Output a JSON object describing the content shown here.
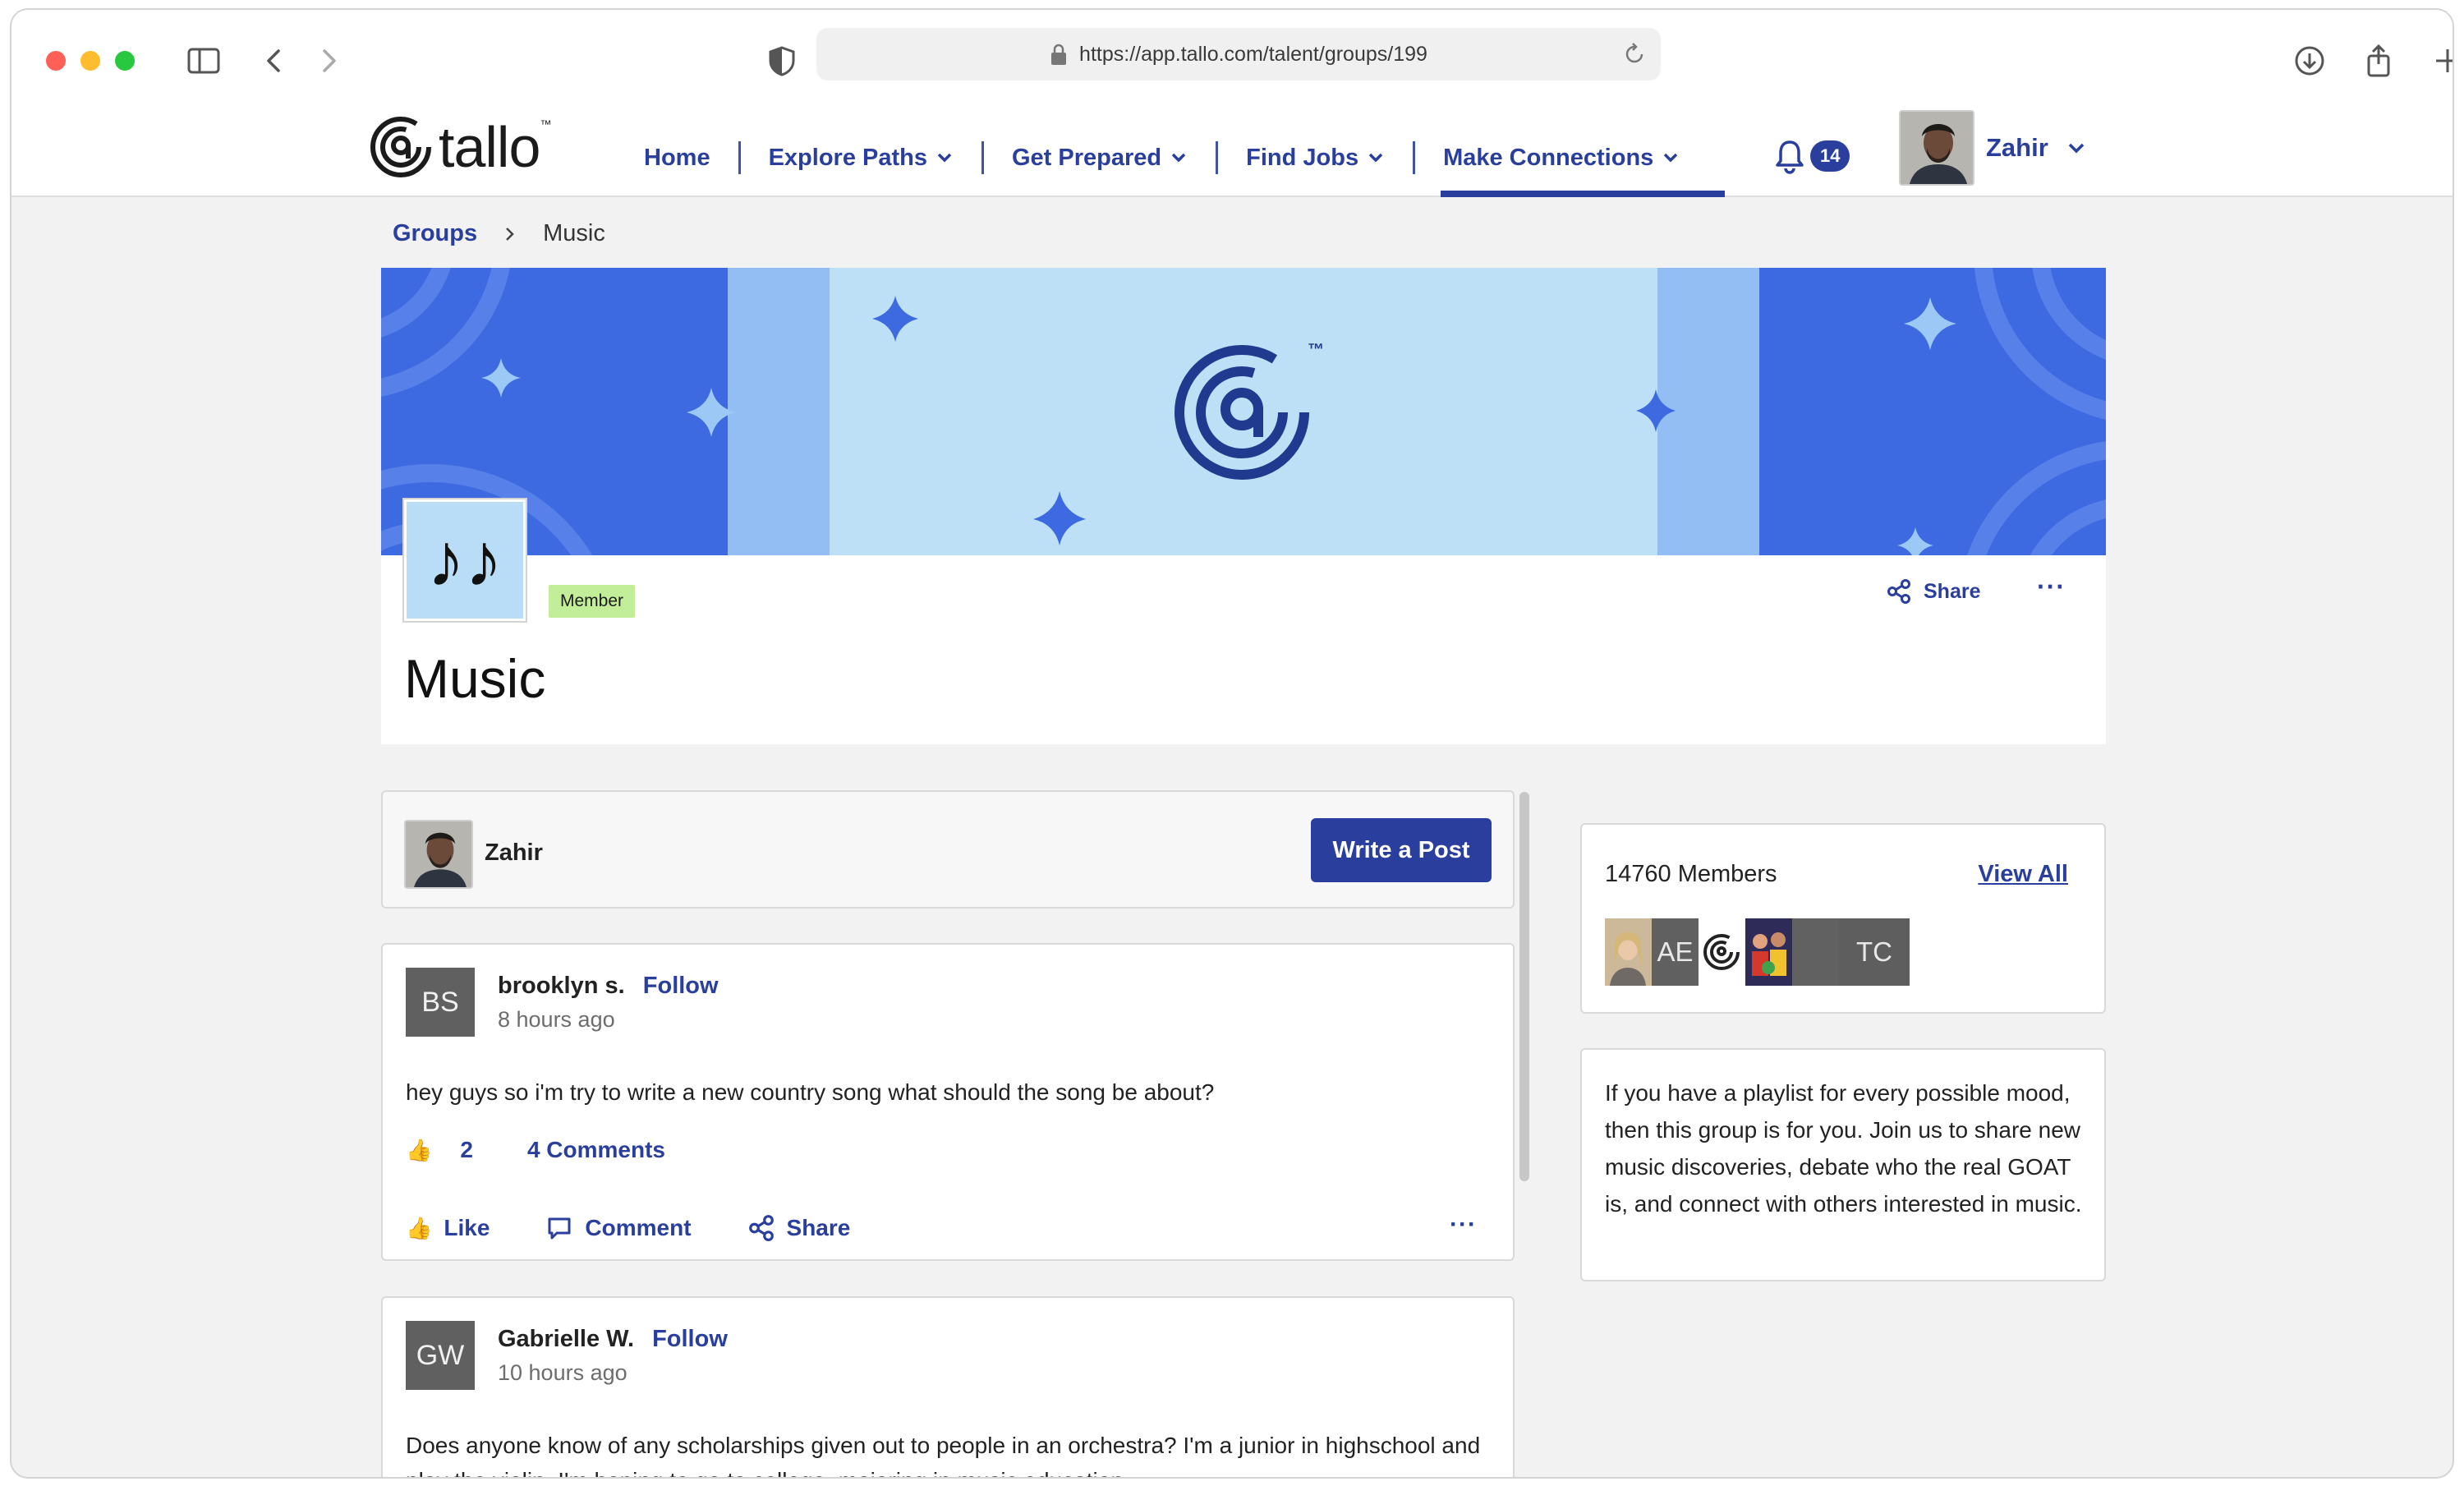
{
  "browser": {
    "url": "https://app.tallo.com/talent/groups/199"
  },
  "header": {
    "logo_text": "tallo",
    "logo_tm": "™",
    "nav": [
      {
        "label": "Home"
      },
      {
        "label": "Explore Paths"
      },
      {
        "label": "Get Prepared"
      },
      {
        "label": "Find Jobs"
      },
      {
        "label": "Make Connections"
      }
    ],
    "active_nav": "Make Connections",
    "notification_count": "14",
    "user_name": "Zahir"
  },
  "breadcrumb": {
    "parent": "Groups",
    "current": "Music"
  },
  "group": {
    "avatar_glyph": "♪♪",
    "badge": "Member",
    "title": "Music",
    "share_label": "Share",
    "more_label": "···",
    "banner_tm": "™"
  },
  "compose": {
    "user_name": "Zahir",
    "button_label": "Write a Post"
  },
  "posts": [
    {
      "initials": "BS",
      "author": "brooklyn s.",
      "follow_label": "Follow",
      "time": "8 hours ago",
      "body": "hey guys so i'm try to write a new country song what should the song be about?",
      "like_count": "2",
      "comments_label": "4 Comments",
      "actions": {
        "like": "Like",
        "comment": "Comment",
        "share": "Share",
        "more": "···"
      }
    },
    {
      "initials": "GW",
      "author": "Gabrielle W.",
      "follow_label": "Follow",
      "time": "10 hours ago",
      "body": "Does anyone know of any scholarships given out to people in an orchestra? I'm a junior in highschool and play the violin. I'm hoping to go to college, majoring in music education."
    }
  ],
  "sidebar": {
    "members_count": "14760 Members",
    "view_all_label": "View All",
    "member_initials": [
      "AE",
      "TC"
    ],
    "about": "If you have a playlist for every possible mood, then this group is for you. Join us to share new music discoveries, debate who the real GOAT is, and connect with others interested in music."
  },
  "colors": {
    "brand_blue": "#2a3f9d",
    "banner_dark": "#3d6ae0",
    "banner_mid": "#93bef4",
    "banner_light": "#bde0f7",
    "badge_green": "#c3ee99"
  }
}
